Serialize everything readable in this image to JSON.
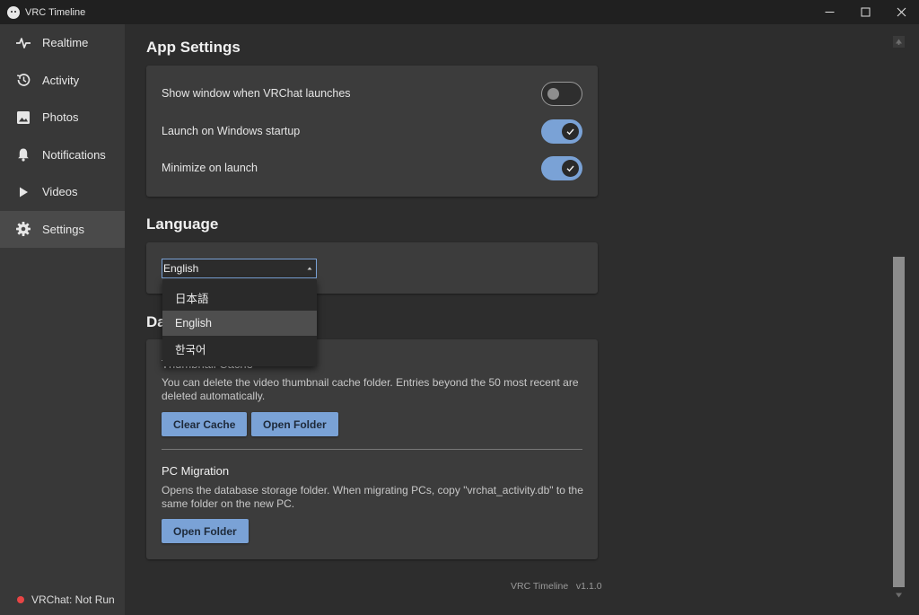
{
  "window": {
    "title": "VRC Timeline",
    "controls": [
      "minimize-icon",
      "maximize-icon",
      "close-icon"
    ]
  },
  "sidebar": {
    "items": [
      {
        "label": "Realtime",
        "icon": "pulse-icon",
        "active": false
      },
      {
        "label": "Activity",
        "icon": "history-icon",
        "active": false
      },
      {
        "label": "Photos",
        "icon": "image-icon",
        "active": false
      },
      {
        "label": "Notifications",
        "icon": "bell-icon",
        "active": false
      },
      {
        "label": "Videos",
        "icon": "play-icon",
        "active": false
      },
      {
        "label": "Settings",
        "icon": "gear-icon",
        "active": true
      }
    ],
    "status": {
      "text": "VRChat: Not Run",
      "color": "#e84545"
    }
  },
  "app_settings": {
    "title": "App Settings",
    "rows": [
      {
        "label": "Show window when VRChat launches",
        "enabled": false
      },
      {
        "label": "Launch on Windows startup",
        "enabled": true
      },
      {
        "label": "Minimize on launch",
        "enabled": true
      }
    ]
  },
  "language": {
    "title": "Language",
    "selected": "English",
    "options": [
      "日本語",
      "English",
      "한국어"
    ]
  },
  "data": {
    "title_visible": "Da",
    "thumbnail": {
      "title": "Thumbnail Cache",
      "description": "You can delete the video thumbnail cache folder. Entries beyond the 50 most recent are deleted automatically.",
      "clear_label": "Clear Cache",
      "open_label": "Open Folder"
    },
    "migration": {
      "title": "PC Migration",
      "description": "Opens the database storage folder. When migrating PCs, copy \"vrchat_activity.db\" to the same folder on the new PC.",
      "open_label": "Open Folder"
    }
  },
  "footer": {
    "text": "VRC Timeline   v1.1.0"
  },
  "colors": {
    "accent": "#7aa2d6",
    "sidebar_bg": "#383838",
    "main_bg": "#2d2d2d",
    "card_bg": "#3c3c3c"
  }
}
